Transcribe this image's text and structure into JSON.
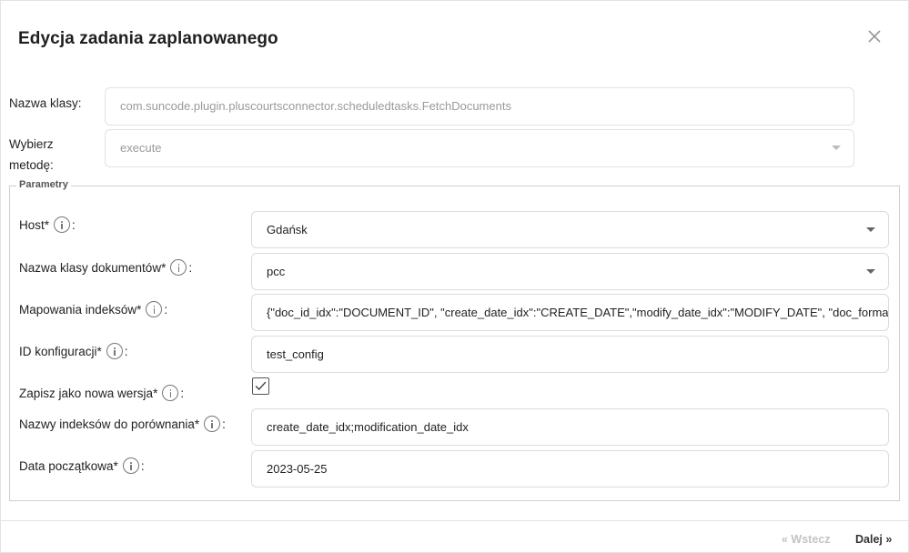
{
  "dialog": {
    "title": "Edycja zadania zaplanowanego"
  },
  "class_name": {
    "label": "Nazwa klasy:",
    "value": "com.suncode.plugin.pluscourtsconnector.scheduledtasks.FetchDocuments"
  },
  "method": {
    "label_line1": "Wybierz",
    "label_line2": "metodę:",
    "value": "execute"
  },
  "parameters": {
    "legend": "Parametry",
    "host": {
      "label": "Host*",
      "colon": ":",
      "value": "Gdańsk"
    },
    "doc_class": {
      "label": "Nazwa klasy dokumentów*",
      "colon": ":",
      "value": "pcc"
    },
    "index_mapping": {
      "label": "Mapowania indeksów*",
      "colon": ":",
      "value": "{\"doc_id_idx\":\"DOCUMENT_ID\", \"create_date_idx\":\"CREATE_DATE\",\"modify_date_idx\":\"MODIFY_DATE\", \"doc_format_"
    },
    "config_id": {
      "label": "ID konfiguracji*",
      "colon": ":",
      "value": "test_config"
    },
    "save_as_version": {
      "label": "Zapisz jako nowa wersja*",
      "colon": ":",
      "checked": true
    },
    "compare_indexes": {
      "label": "Nazwy indeksów do porównania*",
      "colon": ":",
      "value": "create_date_idx;modification_date_idx"
    },
    "start_date": {
      "label": "Data początkowa*",
      "colon": ":",
      "value": "2023-05-25"
    }
  },
  "footer": {
    "back_label": "« Wstecz",
    "next_label": "Dalej »"
  },
  "icons": {
    "close": "close-icon",
    "info": "info-icon",
    "caret": "chevron-down-icon",
    "check": "check-icon"
  }
}
